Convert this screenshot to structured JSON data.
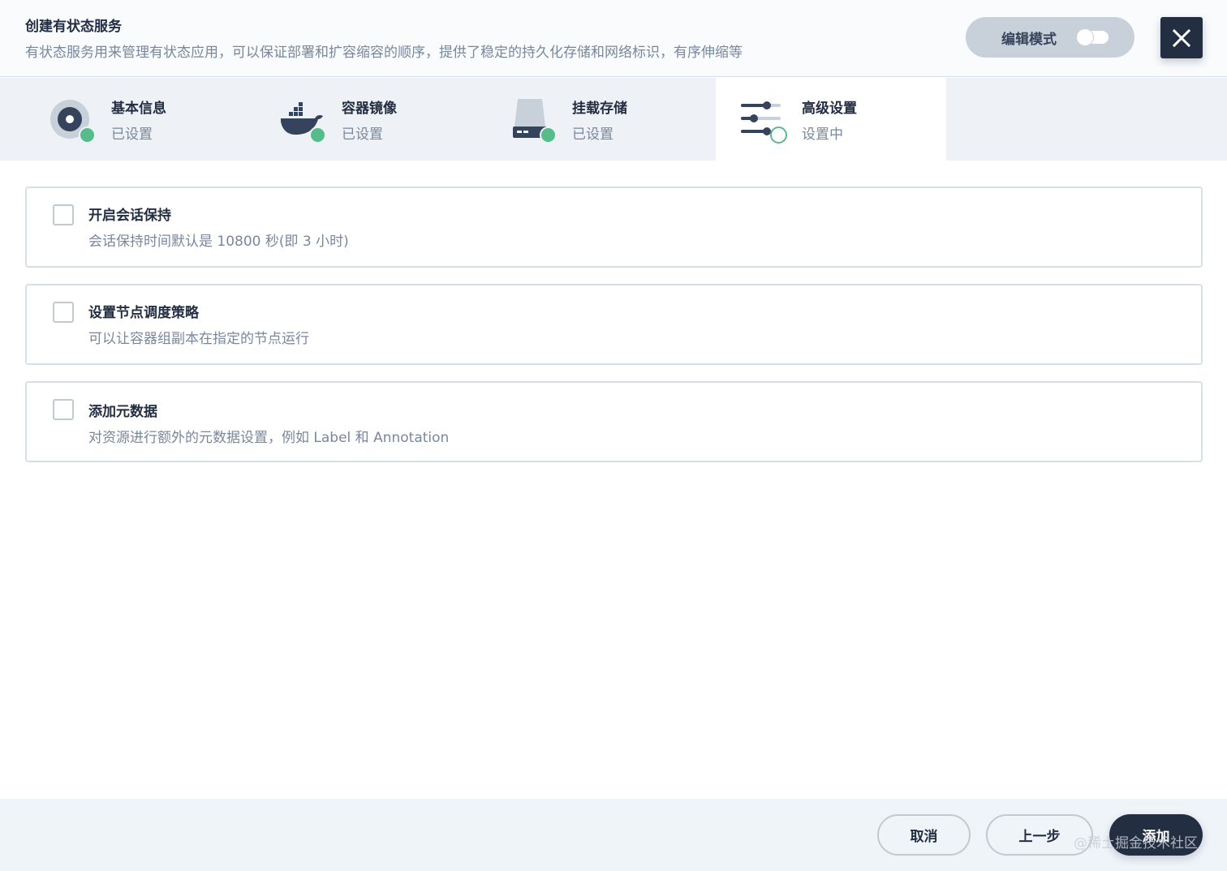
{
  "header": {
    "title": "创建有状态服务",
    "description": "有状态服务用来管理有状态应用，可以保证部署和扩容缩容的顺序，提供了稳定的持久化存储和网络标识，有序伸缩等",
    "edit_mode_label": "编辑模式",
    "edit_mode_on": false,
    "close_icon": "close-icon"
  },
  "steps": [
    {
      "title": "基本信息",
      "status": "已设置",
      "icon": "basic-info-icon",
      "done": true
    },
    {
      "title": "容器镜像",
      "status": "已设置",
      "icon": "docker-icon",
      "done": true
    },
    {
      "title": "挂载存储",
      "status": "已设置",
      "icon": "storage-icon",
      "done": true
    },
    {
      "title": "高级设置",
      "status": "设置中",
      "icon": "sliders-icon",
      "done": false,
      "active": true
    }
  ],
  "options": [
    {
      "title": "开启会话保持",
      "description": "会话保持时间默认是 10800 秒(即 3 小时)",
      "checked": false
    },
    {
      "title": "设置节点调度策略",
      "description": "可以让容器组副本在指定的节点运行",
      "checked": false
    },
    {
      "title": "添加元数据",
      "description": "对资源进行额外的元数据设置，例如 Label 和 Annotation",
      "checked": false
    }
  ],
  "footer": {
    "cancel_label": "取消",
    "prev_label": "上一步",
    "add_label": "添加"
  },
  "watermark": "@稀土掘金技术社区",
  "colors": {
    "primary_dark": "#242e42",
    "success_green": "#55bc8a",
    "muted_text": "#79879c",
    "border": "#d8dee5"
  }
}
